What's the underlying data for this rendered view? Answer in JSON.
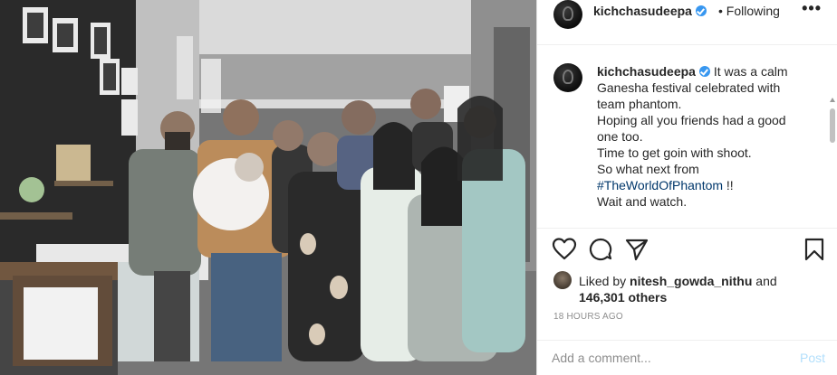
{
  "post": {
    "username": "kichchasudeepa",
    "follow_separator": "•",
    "follow_status": "Following",
    "more_icon": "more-horizontal-icon"
  },
  "caption": {
    "username": "kichchasudeepa",
    "lines": [
      "It was a calm",
      "Ganesha festival celebrated with",
      "team phantom.",
      "Hoping all you friends had a good",
      "one too.",
      "Time to get goin with shoot.",
      "So what next from",
      "#TheWorldOfPhantom",
      "!!",
      "Wait and watch."
    ]
  },
  "actions": {
    "like_icon": "heart-icon",
    "comment_icon": "comment-icon",
    "share_icon": "share-icon",
    "save_icon": "bookmark-icon"
  },
  "likes": {
    "prefix": "Liked by ",
    "user": "nitesh_gowda_nithu",
    "and": " and",
    "count": "146,301 others"
  },
  "timestamp": "18 HOURS AGO",
  "comment": {
    "placeholder": "Add a comment...",
    "post_label": "Post"
  },
  "colors": {
    "verified": "#3897f0",
    "hashtag": "#00376b",
    "post_button_disabled": "#b2dffc",
    "muted_text": "#8e8e8e"
  }
}
